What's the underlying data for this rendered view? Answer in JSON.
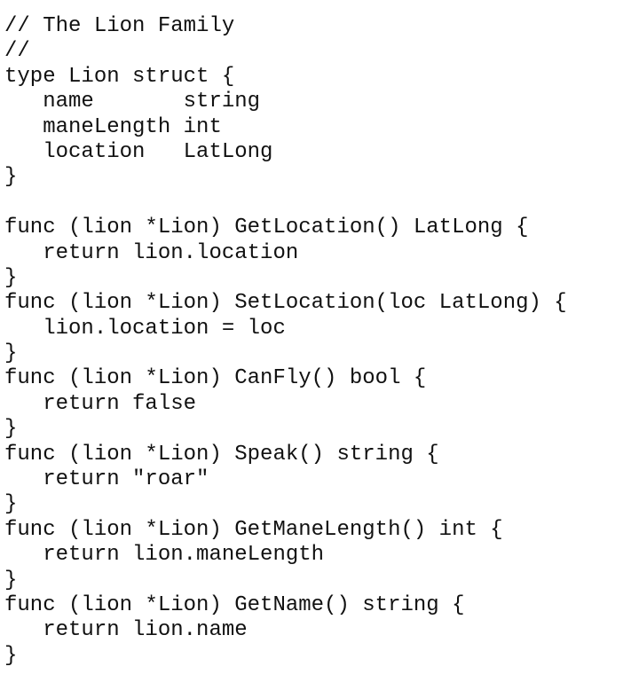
{
  "code": {
    "lines": [
      "// The Lion Family",
      "//",
      "type Lion struct {",
      "   name       string",
      "   maneLength int",
      "   location   LatLong",
      "}",
      "",
      "func (lion *Lion) GetLocation() LatLong {",
      "   return lion.location",
      "}",
      "func (lion *Lion) SetLocation(loc LatLong) {",
      "   lion.location = loc",
      "}",
      "func (lion *Lion) CanFly() bool {",
      "   return false",
      "}",
      "func (lion *Lion) Speak() string {",
      "   return \"roar\"",
      "}",
      "func (lion *Lion) GetManeLength() int {",
      "   return lion.maneLength",
      "}",
      "func (lion *Lion) GetName() string {",
      "   return lion.name",
      "}"
    ]
  }
}
